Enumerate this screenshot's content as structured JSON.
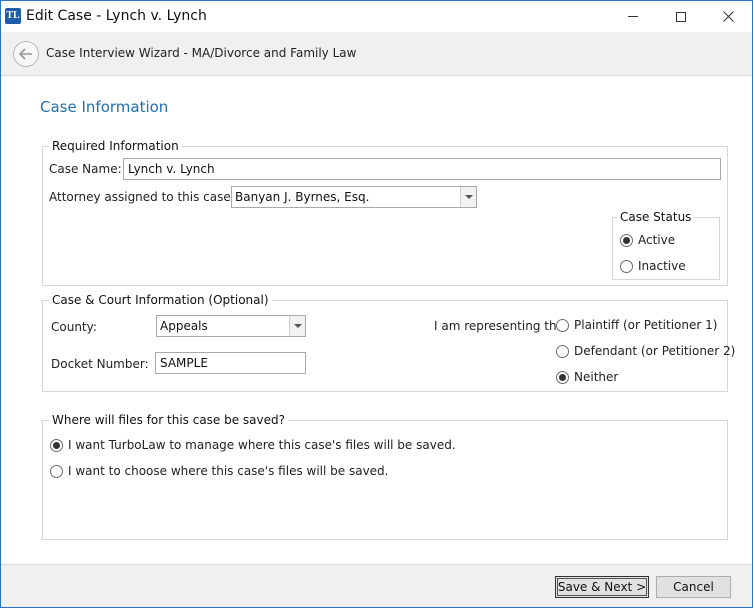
{
  "window": {
    "title": "Edit Case - Lynch v. Lynch",
    "icon_text": "TL"
  },
  "wizard": {
    "title": "Case Interview Wizard - MA/Divorce and Family Law"
  },
  "section_title": "Case Information",
  "required_info": {
    "legend": "Required Information",
    "case_name_label": "Case Name:",
    "case_name_value": "Lynch v. Lynch",
    "attorney_label": "Attorney assigned to this case:",
    "attorney_value": "Banyan J. Byrnes, Esq.",
    "case_status": {
      "legend": "Case Status",
      "options": [
        {
          "label": "Active",
          "selected": true
        },
        {
          "label": "Inactive",
          "selected": false
        }
      ]
    }
  },
  "court_info": {
    "legend": "Case & Court Information (Optional)",
    "county_label": "County:",
    "county_value": "Appeals",
    "docket_label": "Docket Number:",
    "docket_value": "SAMPLE",
    "representing_label": "I am representing the:",
    "representing_options": [
      {
        "label": "Plaintiff (or Petitioner 1)",
        "selected": false
      },
      {
        "label": "Defendant (or Petitioner 2)",
        "selected": false
      },
      {
        "label": "Neither",
        "selected": true
      }
    ]
  },
  "files": {
    "legend": "Where will files for this case be saved?",
    "options": [
      {
        "label": "I want TurboLaw to manage where this case's files will be saved.",
        "selected": true
      },
      {
        "label": "I want to choose where this case's files will be saved.",
        "selected": false
      }
    ]
  },
  "footer": {
    "save_next_label": "Save & Next >",
    "cancel_label": "Cancel"
  },
  "colors": {
    "accent": "#1f6fb2",
    "window_border": "#2b74c4"
  }
}
